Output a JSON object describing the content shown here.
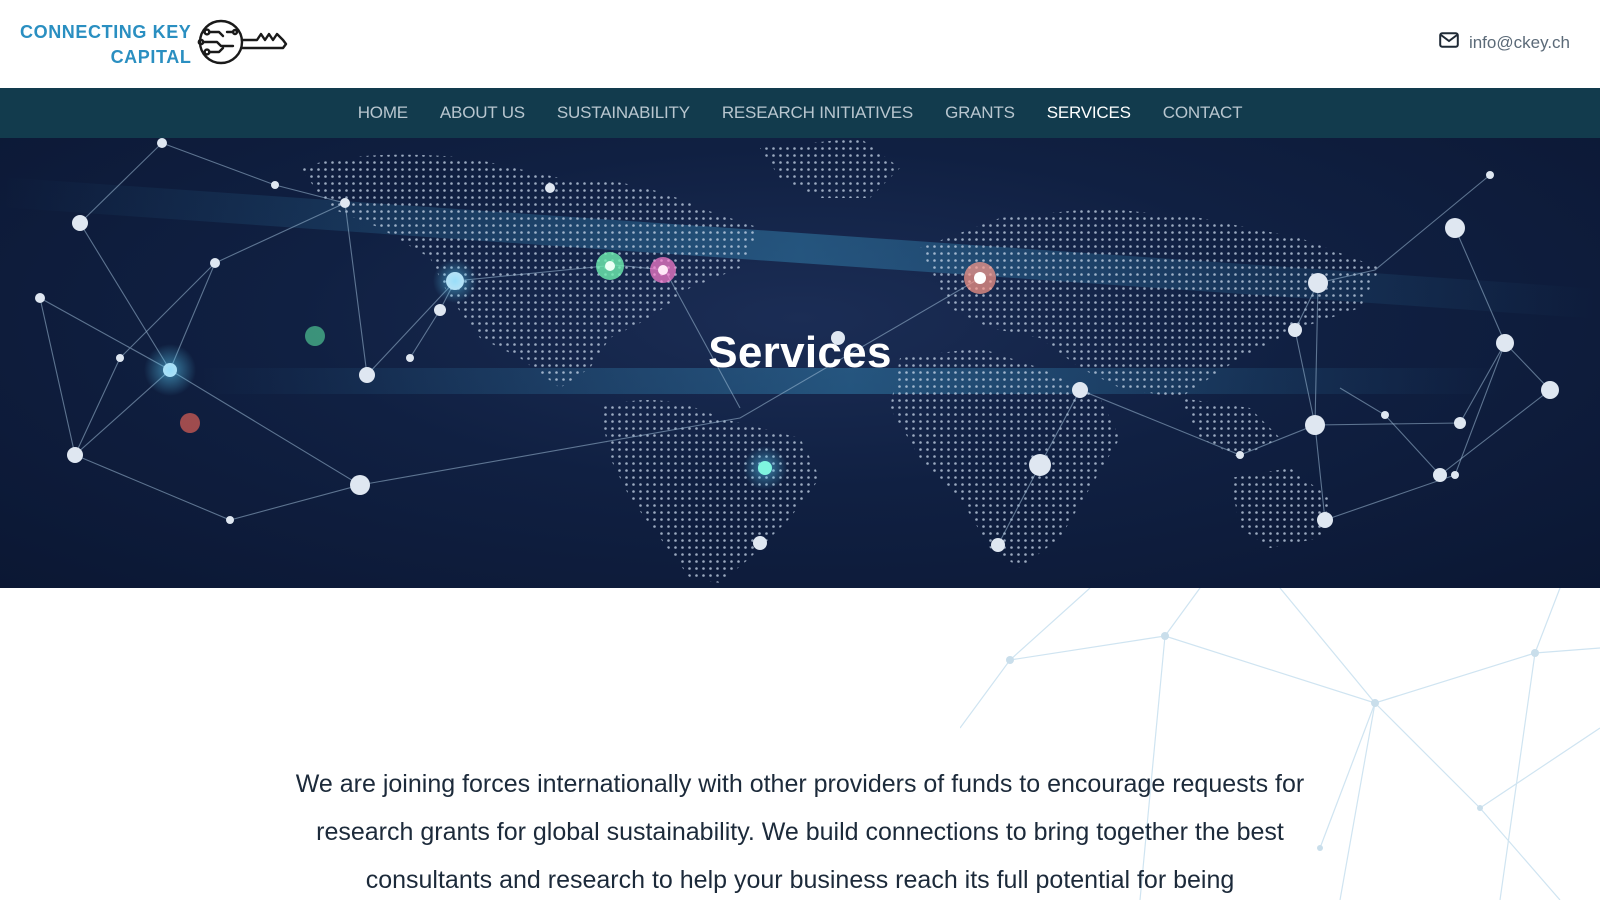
{
  "brand": {
    "line1": "CONNECTING KEY",
    "line2": "CAPITAL",
    "accent_color": "#2a8fc1"
  },
  "contact": {
    "email": "info@ckey.ch",
    "icon": "envelope-icon"
  },
  "nav": {
    "background": "#123b4d",
    "items": [
      {
        "label": "HOME",
        "active": false
      },
      {
        "label": "ABOUT US",
        "active": false
      },
      {
        "label": "SUSTAINABILITY",
        "active": false
      },
      {
        "label": "RESEARCH INITIATIVES",
        "active": false
      },
      {
        "label": "GRANTS",
        "active": false
      },
      {
        "label": "SERVICES",
        "active": true
      },
      {
        "label": "CONTACT",
        "active": false
      }
    ]
  },
  "hero": {
    "title": "Services"
  },
  "main": {
    "intro": "We are joining forces internationally with other providers of funds to encourage requests for research grants for global sustainability. We build connections to bring together the best consultants and research to help your business reach its full potential for being"
  }
}
